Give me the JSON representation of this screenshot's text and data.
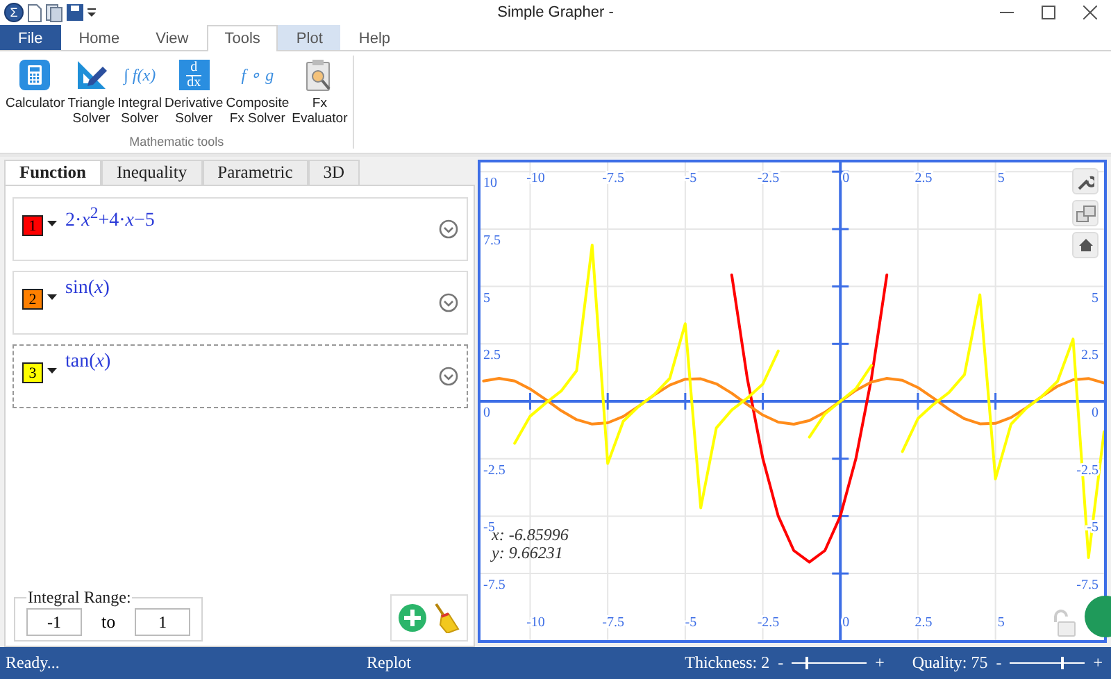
{
  "window": {
    "logo": "Σ",
    "title": "Simple Grapher -"
  },
  "menu_tabs": [
    {
      "label": "File",
      "kind": "file",
      "selected": false
    },
    {
      "label": "Home",
      "kind": "normal",
      "selected": false
    },
    {
      "label": "View",
      "kind": "normal",
      "selected": false
    },
    {
      "label": "Tools",
      "kind": "normal",
      "selected": true
    },
    {
      "label": "Plot",
      "kind": "contextual",
      "selected": false
    },
    {
      "label": "Help",
      "kind": "normal",
      "selected": false
    }
  ],
  "ribbon": {
    "group_label": "Mathematic tools",
    "tools": [
      {
        "kind": "calculator",
        "label_lines": [
          "Calculator"
        ]
      },
      {
        "kind": "triangle",
        "label_lines": [
          "Triangle",
          "Solver"
        ]
      },
      {
        "kind": "integral",
        "glyph": "∫ f(x)",
        "label_lines": [
          "Integral",
          "Solver"
        ]
      },
      {
        "kind": "derivative",
        "glyph": "d",
        "glyph_lower": "dx",
        "label_lines": [
          "Derivative",
          "Solver"
        ]
      },
      {
        "kind": "composite",
        "glyph": "f ∘ g",
        "label_lines": [
          "Composite",
          "Fx Solver"
        ]
      },
      {
        "kind": "evaluator",
        "label_lines": [
          "Fx",
          "Evaluator"
        ]
      }
    ]
  },
  "function_panel": {
    "tabs": [
      {
        "label": "Function",
        "selected": true
      },
      {
        "label": "Inequality",
        "selected": false
      },
      {
        "label": "Parametric",
        "selected": false
      },
      {
        "label": "3D",
        "selected": false
      }
    ],
    "functions": [
      {
        "number": "1",
        "color": "#ff0000",
        "expression": "2·*x*$^{2}$+4·*x*−5",
        "selected": false
      },
      {
        "number": "2",
        "color": "#ff8000",
        "expression": "sin(*x*)",
        "selected": false
      },
      {
        "number": "3",
        "color": "#ffff00",
        "expression": "tan(*x*)",
        "selected": true
      }
    ],
    "integral_range": {
      "label": "Integral Range:",
      "from": "-1",
      "separator": "to",
      "to": "1"
    }
  },
  "plot": {
    "chart_data": {
      "type": "line",
      "grid": true,
      "x": [
        -11.5,
        -11,
        -10.5,
        -10,
        -9.5,
        -9,
        -8.5,
        -8,
        -7.5,
        -7,
        -6.5,
        -6,
        -5.5,
        -5,
        -4.5,
        -4,
        -3.5,
        -3,
        -2.5,
        -2,
        -1.5,
        -1,
        -0.5,
        0,
        0.5,
        1,
        1.5,
        2,
        2.5,
        3,
        3.5,
        4,
        4.5,
        5,
        5.5,
        6,
        6.5,
        7,
        7.5,
        8,
        8.5
      ],
      "series": [
        {
          "color": "#ff0000",
          "values": [
            null,
            null,
            null,
            null,
            null,
            null,
            null,
            null,
            null,
            null,
            null,
            null,
            null,
            null,
            null,
            null,
            5.5,
            1,
            -2.5,
            -5,
            -6.5,
            -7,
            -6.5,
            -5,
            -2.5,
            1,
            5.5,
            null,
            null,
            null,
            null,
            null,
            null,
            null,
            null,
            null,
            null,
            null,
            null,
            null,
            null
          ]
        },
        {
          "color": "#ff8c1a",
          "values": [
            0.88,
            1.0,
            0.88,
            0.54,
            0.08,
            -0.41,
            -0.8,
            -0.99,
            -0.94,
            -0.66,
            -0.22,
            0.28,
            0.71,
            0.96,
            0.98,
            0.76,
            0.35,
            -0.14,
            -0.6,
            -0.91,
            -1.0,
            -0.84,
            -0.48,
            0,
            0.48,
            0.84,
            1.0,
            0.91,
            0.6,
            0.14,
            -0.35,
            -0.76,
            -0.98,
            -0.96,
            -0.71,
            -0.28,
            0.22,
            0.66,
            0.94,
            0.99,
            0.8
          ]
        },
        {
          "color": "#ffff00",
          "values": [
            null,
            null,
            -1.83,
            -0.65,
            -0.08,
            0.45,
            1.33,
            6.8,
            -2.71,
            -0.87,
            -0.22,
            0.29,
            1.0,
            3.38,
            -4.64,
            -1.16,
            -0.38,
            0.14,
            0.75,
            2.19,
            null,
            -1.56,
            -0.55,
            0,
            0.55,
            1.56,
            null,
            -2.19,
            -0.75,
            -0.14,
            0.38,
            1.16,
            4.64,
            -3.38,
            -1.0,
            -0.29,
            0.22,
            0.87,
            2.71,
            -6.8,
            -1.33
          ]
        }
      ],
      "xlim": [
        -11.6,
        8.5
      ],
      "ylim": [
        -10.4,
        10.4
      ],
      "xticks": [
        -10,
        -7.5,
        -5,
        -2.5,
        0,
        2.5,
        5
      ],
      "yticks": [
        -7.5,
        -5,
        -2.5,
        0,
        2.5,
        5,
        7.5,
        10
      ]
    },
    "bottom_tick_labels": [
      "-10",
      "-7.5",
      "-5",
      "-2.5",
      "0",
      "2.5",
      "5"
    ],
    "right_tick_labels": [
      "5",
      "2.5",
      "0",
      "-2.5",
      "-5",
      "-7.5"
    ],
    "readout": [
      "x: -6.85996",
      "y: 9.66231"
    ]
  },
  "status_bar": {
    "status": "Ready...",
    "replot": "Replot",
    "thickness": {
      "label": "Thickness: 2",
      "decrease": "-",
      "increase": "+",
      "level": 0.2
    },
    "quality": {
      "label": "Quality: 75",
      "decrease": "-",
      "increase": "+",
      "level": 0.7
    }
  }
}
